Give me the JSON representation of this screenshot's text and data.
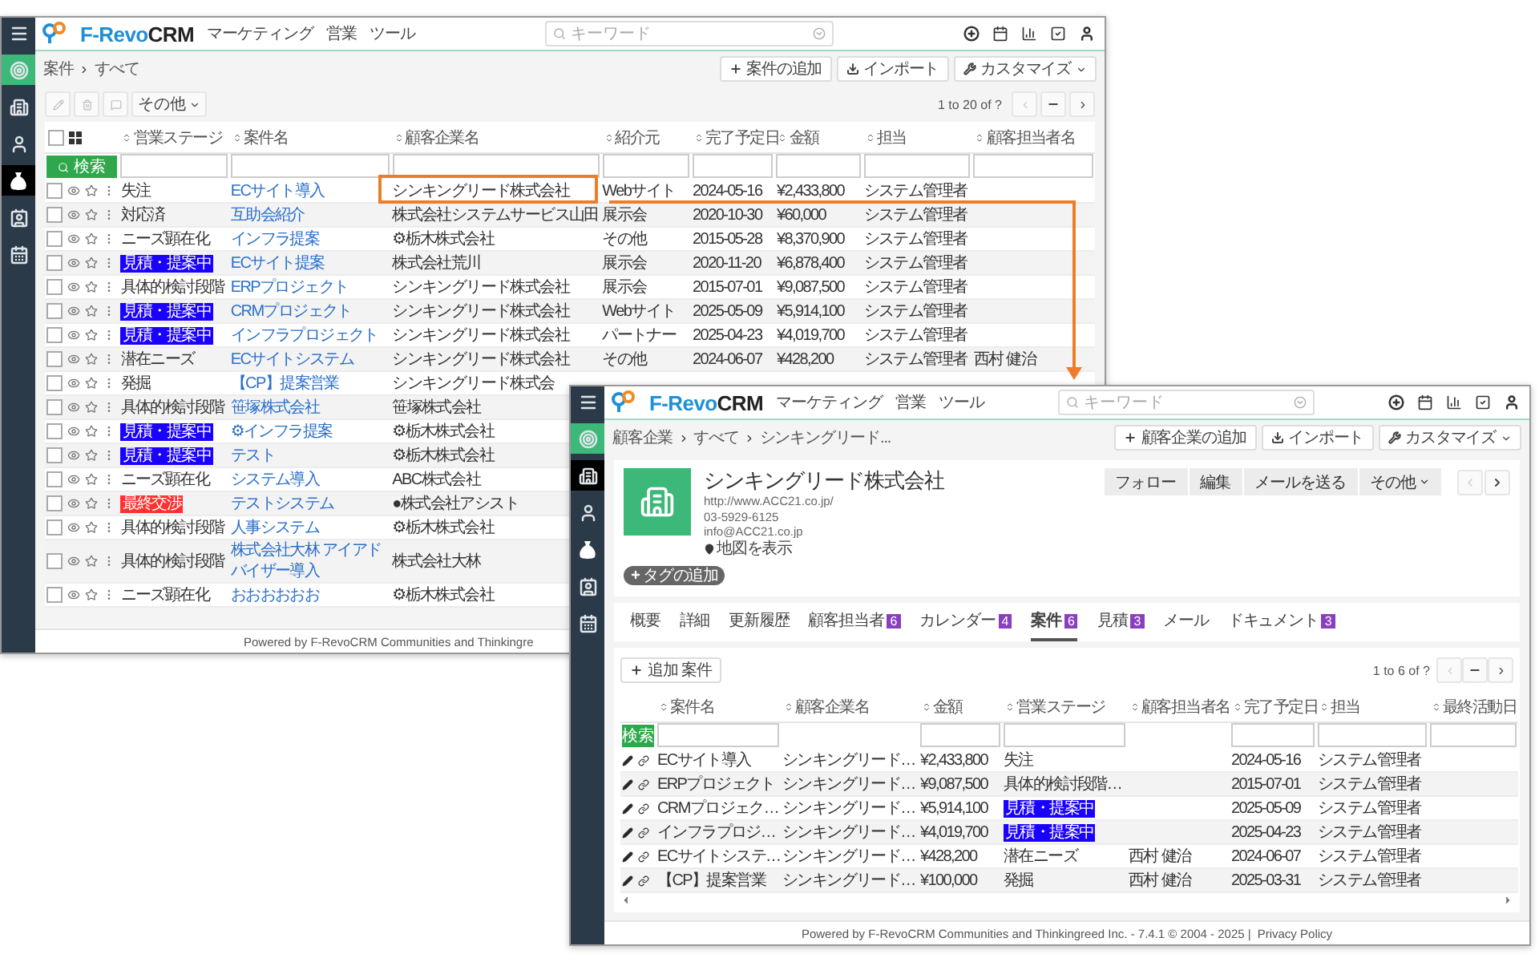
{
  "back_window": {
    "logo": [
      "F-Revo",
      "CRM"
    ],
    "nav": [
      "マーケティング",
      "営業",
      "ツール"
    ],
    "search": {
      "placeholder": "キーワード"
    },
    "sidebar": [
      {
        "kind": "menu",
        "selected": false
      },
      {
        "kind": "home",
        "selected": false
      },
      {
        "kind": "accounts",
        "selected": false
      },
      {
        "kind": "contacts",
        "selected": false
      },
      {
        "kind": "deals",
        "selected": true
      },
      {
        "kind": "documents",
        "selected": false
      },
      {
        "kind": "calendar",
        "selected": false
      }
    ],
    "breadcrumb": [
      "案件",
      "すべて"
    ],
    "actions": [
      {
        "kind": "add",
        "label": "案件の追加"
      },
      {
        "kind": "import",
        "label": "インポート"
      },
      {
        "kind": "customize",
        "label": "カスタマイズ"
      }
    ],
    "more_button": "その他",
    "pager": "1 to 20 of ?",
    "header_checked": false,
    "search_button": "検索",
    "columns": [
      "営業ステージ",
      "案件名",
      "顧客企業名",
      "紹介元",
      "完了予定日",
      "金額",
      "担当",
      "顧客担当者名"
    ],
    "rows": [
      {
        "checked": false,
        "starred": false,
        "highlighted": true,
        "cells": [
          {
            "text": "失注"
          },
          {
            "text": "ECサイト導入"
          },
          {
            "text": "シンキングリード株式会社"
          },
          {
            "text": "Webサイト"
          },
          {
            "text": "2024-05-16"
          },
          {
            "text": "¥2,433,800"
          },
          {
            "text": "システム管理者"
          }
        ]
      },
      {
        "checked": false,
        "starred": false,
        "highlighted": false,
        "cells": [
          {
            "text": "対応済"
          },
          {
            "text": "互助会紹介"
          },
          {
            "text": "株式会社システムサービス山田"
          },
          {
            "text": "展示会"
          },
          {
            "text": "2020-10-30"
          },
          {
            "text": "¥60,000"
          },
          {
            "text": "システム管理者"
          }
        ]
      },
      {
        "checked": false,
        "starred": false,
        "highlighted": false,
        "cells": [
          {
            "text": "ニーズ顕在化"
          },
          {
            "text": "インフラ提案"
          },
          {
            "text": "⚙栃木株式会社"
          },
          {
            "text": "その他"
          },
          {
            "text": "2015-05-28"
          },
          {
            "text": "¥8,370,900"
          },
          {
            "text": "システム管理者"
          }
        ]
      },
      {
        "checked": false,
        "starred": false,
        "highlighted": false,
        "cells": [
          {
            "text": "見積・提案中",
            "color": "#1a00ff"
          },
          {
            "text": "ECサイト提案"
          },
          {
            "text": "株式会社荒川"
          },
          {
            "text": "展示会"
          },
          {
            "text": "2020-11-20"
          },
          {
            "text": "¥6,878,400"
          },
          {
            "text": "システム管理者"
          }
        ]
      },
      {
        "checked": false,
        "starred": false,
        "highlighted": false,
        "cells": [
          {
            "text": "具体的検討段階"
          },
          {
            "text": "ERPプロジェクト"
          },
          {
            "text": "シンキングリード株式会社"
          },
          {
            "text": "展示会"
          },
          {
            "text": "2015-07-01"
          },
          {
            "text": "¥9,087,500"
          },
          {
            "text": "システム管理者"
          }
        ]
      },
      {
        "checked": false,
        "starred": false,
        "highlighted": false,
        "cells": [
          {
            "text": "見積・提案中",
            "color": "#1a00ff"
          },
          {
            "text": "CRMプロジェクト"
          },
          {
            "text": "シンキングリード株式会社"
          },
          {
            "text": "Webサイト"
          },
          {
            "text": "2025-05-09"
          },
          {
            "text": "¥5,914,100"
          },
          {
            "text": "システム管理者"
          }
        ]
      },
      {
        "checked": false,
        "starred": false,
        "highlighted": false,
        "cells": [
          {
            "text": "見積・提案中",
            "color": "#1a00ff"
          },
          {
            "text": "インフラプロジェクト"
          },
          {
            "text": "シンキングリード株式会社"
          },
          {
            "text": "パートナー"
          },
          {
            "text": "2025-04-23"
          },
          {
            "text": "¥4,019,700"
          },
          {
            "text": "システム管理者"
          }
        ]
      },
      {
        "checked": false,
        "starred": false,
        "highlighted": false,
        "cells": [
          {
            "text": "潜在ニーズ"
          },
          {
            "text": "ECサイトシステム"
          },
          {
            "text": "シンキングリード株式会社"
          },
          {
            "text": "その他"
          },
          {
            "text": "2024-06-07"
          },
          {
            "text": "¥428,200"
          },
          {
            "text": "システム管理者"
          },
          {
            "text": "西村 健治"
          }
        ]
      },
      {
        "checked": false,
        "starred": false,
        "highlighted": false,
        "cells": [
          {
            "text": "発掘"
          },
          {
            "text": "【CP】提案営業"
          },
          {
            "text": "シンキングリード株式会"
          }
        ]
      },
      {
        "checked": false,
        "starred": false,
        "highlighted": false,
        "cells": [
          {
            "text": "具体的検討段階"
          },
          {
            "text": "笹塚株式会社"
          },
          {
            "text": "笹塚株式会社"
          }
        ]
      },
      {
        "checked": false,
        "starred": false,
        "highlighted": false,
        "cells": [
          {
            "text": "見積・提案中",
            "color": "#1a00ff"
          },
          {
            "text": "⚙インフラ提案"
          },
          {
            "text": "⚙栃木株式会社"
          }
        ]
      },
      {
        "checked": false,
        "starred": false,
        "highlighted": false,
        "cells": [
          {
            "text": "見積・提案中",
            "color": "#1a00ff"
          },
          {
            "text": "テスト"
          },
          {
            "text": "⚙栃木株式会社"
          }
        ]
      },
      {
        "checked": false,
        "starred": false,
        "highlighted": false,
        "cells": [
          {
            "text": "ニーズ顕在化"
          },
          {
            "text": "システム導入"
          },
          {
            "text": "ABC株式会社"
          }
        ]
      },
      {
        "checked": false,
        "starred": false,
        "highlighted": false,
        "cells": [
          {
            "text": "最終交渉",
            "color": "#ff3030"
          },
          {
            "text": "テストシステム"
          },
          {
            "text": "●株式会社アシスト"
          }
        ]
      },
      {
        "checked": false,
        "starred": false,
        "highlighted": false,
        "cells": [
          {
            "text": "具体的検討段階"
          },
          {
            "text": "人事システム"
          },
          {
            "text": "⚙栃木株式会社"
          }
        ]
      },
      {
        "checked": false,
        "starred": false,
        "highlighted": false,
        "cells": [
          {
            "text": "具体的検討段階"
          },
          {
            "text": "株式会社大林 アイアドバイザー導入"
          },
          {
            "text": "株式会社大林"
          }
        ]
      },
      {
        "checked": false,
        "starred": false,
        "highlighted": false,
        "cells": [
          {
            "text": "ニーズ顕在化"
          },
          {
            "text": "おおおおおお"
          },
          {
            "text": "⚙栃木株式会社"
          }
        ]
      }
    ],
    "footer": "Powered by F-RevoCRM Communities and Thinkingre"
  },
  "front_window": {
    "logo": [
      "F-Revo",
      "CRM"
    ],
    "nav": [
      "マーケティング",
      "営業",
      "ツール"
    ],
    "search": {
      "placeholder": "キーワード"
    },
    "sidebar": [
      {
        "kind": "menu",
        "selected": false
      },
      {
        "kind": "home",
        "selected": false
      },
      {
        "kind": "accounts",
        "selected": true
      },
      {
        "kind": "contacts",
        "selected": false
      },
      {
        "kind": "deals",
        "selected": false
      },
      {
        "kind": "documents",
        "selected": false
      },
      {
        "kind": "calendar",
        "selected": false
      }
    ],
    "breadcrumb": [
      "顧客企業",
      "すべて",
      "シンキングリード..."
    ],
    "actions": [
      {
        "kind": "add",
        "label": "顧客企業の追加"
      },
      {
        "kind": "import",
        "label": "インポート"
      },
      {
        "kind": "customize",
        "label": "カスタマイズ"
      }
    ],
    "record": {
      "title": "シンキングリード株式会社",
      "website": "http://www.ACC21.co.jp/",
      "phone": "03-5929-6125",
      "email": "info@ACC21.co.jp",
      "map_link": "地図を表示",
      "tag_button": "タグの追加"
    },
    "record_actions": [
      "フォロー",
      "編集",
      "メールを送る",
      "その他"
    ],
    "tabs": [
      {
        "label": "概要",
        "selected": false
      },
      {
        "label": "詳細",
        "selected": false
      },
      {
        "label": "更新履歴",
        "selected": false
      },
      {
        "label": "顧客担当者",
        "count": "6",
        "selected": false
      },
      {
        "label": "カレンダー",
        "count": "4",
        "selected": false
      },
      {
        "label": "案件",
        "count": "6",
        "selected": true
      },
      {
        "label": "見積",
        "count": "3",
        "selected": false
      },
      {
        "label": "メール",
        "selected": false
      },
      {
        "label": "ドキュメント",
        "count": "3",
        "selected": false
      }
    ],
    "add_button": "追加 案件",
    "pager": "1 to 6 of ?",
    "search_button": "検索",
    "columns": [
      {
        "label": "案件名",
        "filter": true
      },
      {
        "label": "顧客企業名",
        "filter": false
      },
      {
        "label": "金額",
        "filter": true
      },
      {
        "label": "営業ステージ",
        "filter": true
      },
      {
        "label": "顧客担当者名",
        "filter": false
      },
      {
        "label": "完了予定日",
        "filter": true
      },
      {
        "label": "担当",
        "filter": true
      },
      {
        "label": "最終活動日",
        "filter": true
      }
    ],
    "rows": [
      {
        "name": "ECサイト導入",
        "customer": "シンキングリード…",
        "amount": "¥2,433,800",
        "stage": {
          "text": "失注"
        },
        "date": "2024-05-16",
        "owner": "システム管理者"
      },
      {
        "name": "ERPプロジェクト",
        "customer": "シンキングリード…",
        "amount": "¥9,087,500",
        "stage": {
          "text": "具体的検討段階…"
        },
        "date": "2015-07-01",
        "owner": "システム管理者"
      },
      {
        "name": "CRMプロジェク…",
        "customer": "シンキングリード…",
        "amount": "¥5,914,100",
        "stage": {
          "text": "見積・提案中",
          "color": "#1a00ff"
        },
        "date": "2025-05-09",
        "owner": "システム管理者"
      },
      {
        "name": "インフラプロジ…",
        "customer": "シンキングリード…",
        "amount": "¥4,019,700",
        "stage": {
          "text": "見積・提案中",
          "color": "#1a00ff"
        },
        "date": "2025-04-23",
        "owner": "システム管理者"
      },
      {
        "name": "ECサイトシステ…",
        "customer": "シンキングリード…",
        "amount": "¥428,200",
        "stage": {
          "text": "潜在ニーズ"
        },
        "contact": "西村 健治",
        "date": "2024-06-07",
        "owner": "システム管理者"
      },
      {
        "name": "【CP】提案営業",
        "customer": "シンキングリード…",
        "amount": "¥100,000",
        "stage": {
          "text": "発掘"
        },
        "contact": "西村 健治",
        "date": "2025-03-31",
        "owner": "システム管理者"
      }
    ],
    "footer": "Powered by F-RevoCRM Communities and Thinkingreed Inc. - 7.4.1  © 2004 - 2025  |",
    "privacy_link": "Privacy Policy"
  }
}
